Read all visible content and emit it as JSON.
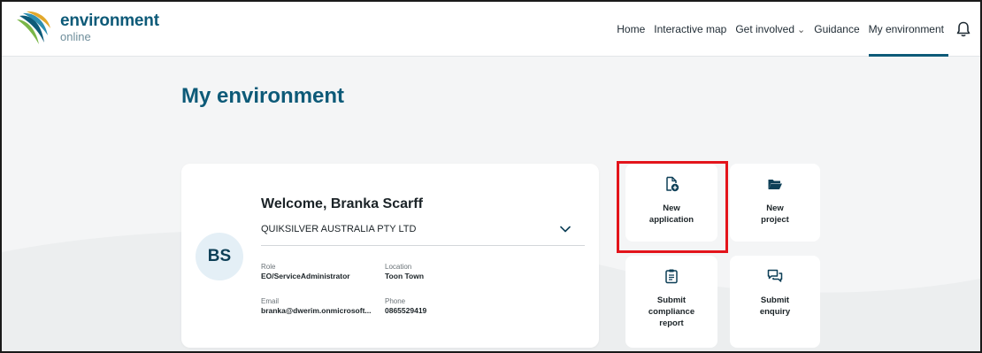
{
  "header": {
    "logo_title": "environment",
    "logo_subtitle": "online",
    "nav": [
      {
        "label": "Home"
      },
      {
        "label": "Interactive map"
      },
      {
        "label": "Get involved",
        "dropdown": "⌄"
      },
      {
        "label": "Guidance"
      },
      {
        "label": "My environment",
        "active": true
      }
    ],
    "bell_icon": "bell-icon"
  },
  "page": {
    "title": "My environment"
  },
  "welcome": {
    "greeting": "Welcome, Branka Scarff",
    "organisation": "QUIKSILVER AUSTRALIA PTY LTD",
    "avatar_initials": "BS",
    "role_label": "Role",
    "role_value": "EO/ServiceAdministrator",
    "location_label": "Location",
    "location_value": "Toon Town",
    "email_label": "Email",
    "email_value": "branka@dwerim.onmicrosoft...",
    "phone_label": "Phone",
    "phone_value": "0865529419"
  },
  "tiles": {
    "new_application": {
      "label": "New\napplication",
      "icon": "file-plus-icon"
    },
    "new_project": {
      "label": "New\nproject",
      "icon": "folder-open-icon"
    },
    "submit_compliance": {
      "label": "Submit\ncompliance\nreport",
      "icon": "clipboard-icon"
    },
    "submit_enquiry": {
      "label": "Submit\nenquiry",
      "icon": "chat-bubbles-icon"
    }
  },
  "colors": {
    "brand": "#0d5a78",
    "highlight": "#e3141b",
    "background": "#f4f5f6"
  }
}
